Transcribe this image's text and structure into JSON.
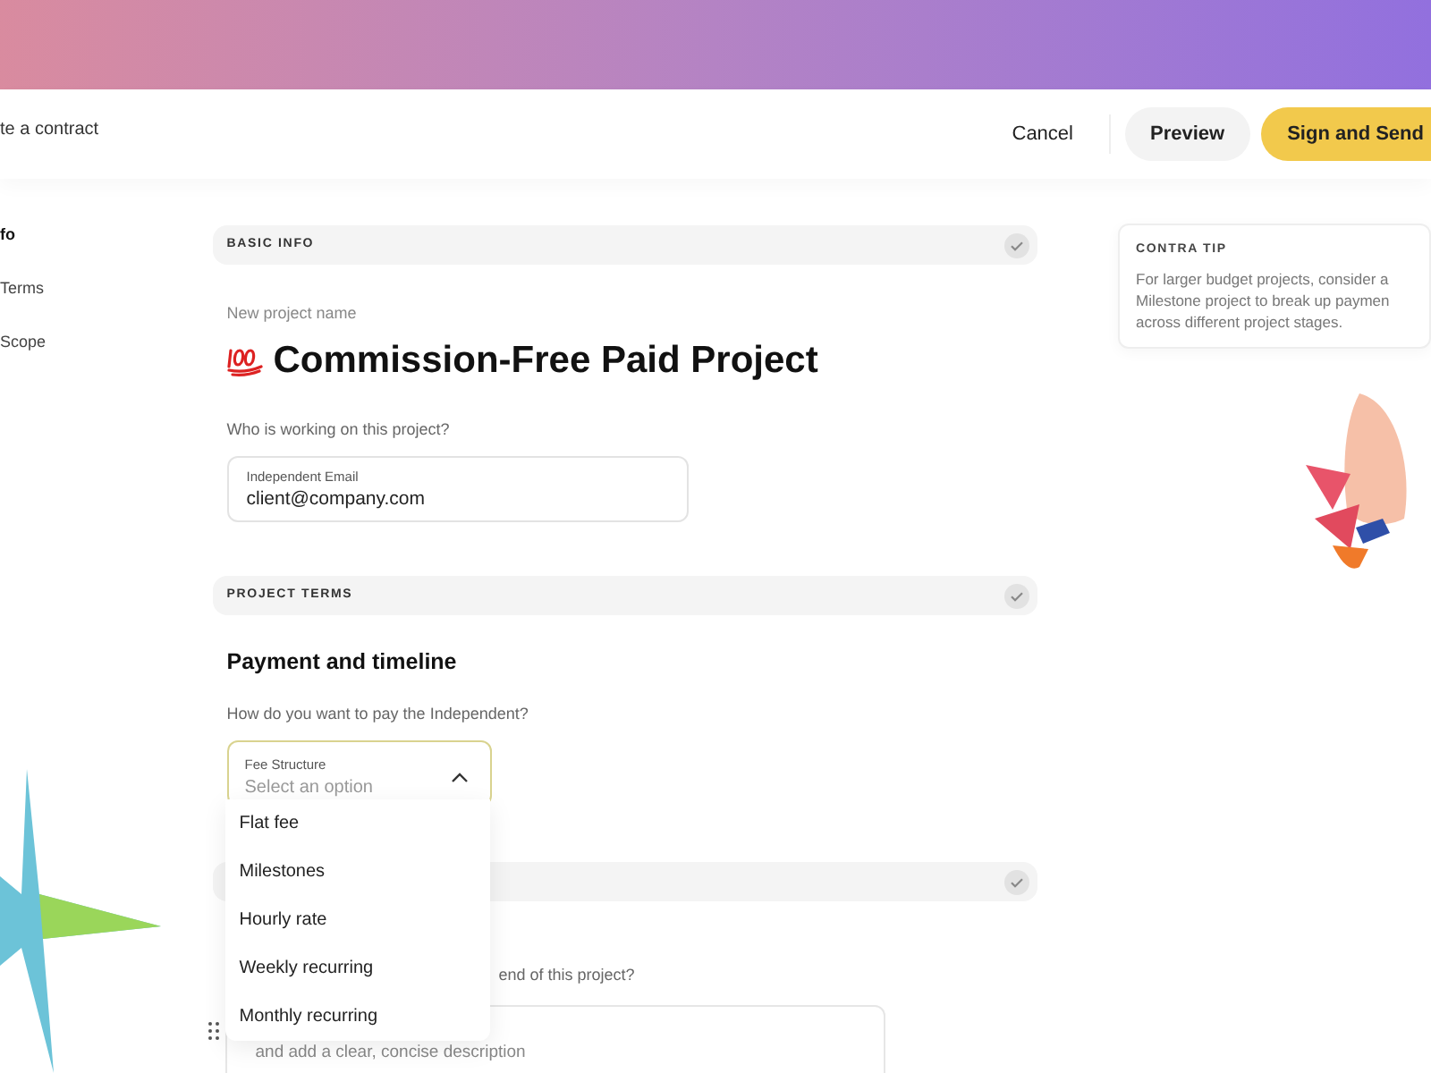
{
  "header": {
    "title": "te a contract",
    "actions": [
      {
        "label": "Cancel",
        "kind": "link"
      },
      {
        "label": "Preview",
        "kind": "secondary"
      },
      {
        "label": "Sign and Send",
        "kind": "primary"
      }
    ]
  },
  "sidebar": {
    "items": [
      {
        "label": "fo",
        "selected": true
      },
      {
        "label": "Terms",
        "selected": false
      },
      {
        "label": "Scope",
        "selected": false
      }
    ]
  },
  "basic_info": {
    "heading": "BASIC INFO",
    "completed": true,
    "name_label": "New project name",
    "project_name": "Commission-Free Paid Project",
    "question": "Who is working on this project?",
    "email_field": {
      "label": "Independent Email",
      "value": "client@company.com"
    }
  },
  "project_terms": {
    "heading": "PROJECT TERMS",
    "completed": true,
    "subtitle": "Payment and timeline",
    "question": "How do you want to pay the Independent?",
    "fee_select": {
      "label": "Fee Structure",
      "placeholder": "Select an option",
      "expanded": true,
      "options": [
        "Flat fee",
        "Milestones",
        "Hourly rate",
        "Weekly recurring",
        "Monthly recurring"
      ]
    }
  },
  "scope": {
    "completed": true,
    "question": "end of this project?",
    "description_placeholder": "and add a clear, concise description"
  },
  "tip": {
    "heading": "CONTRA TIP",
    "text": "For larger budget projects, consider a Milestone project to break up paymen across different project stages."
  }
}
